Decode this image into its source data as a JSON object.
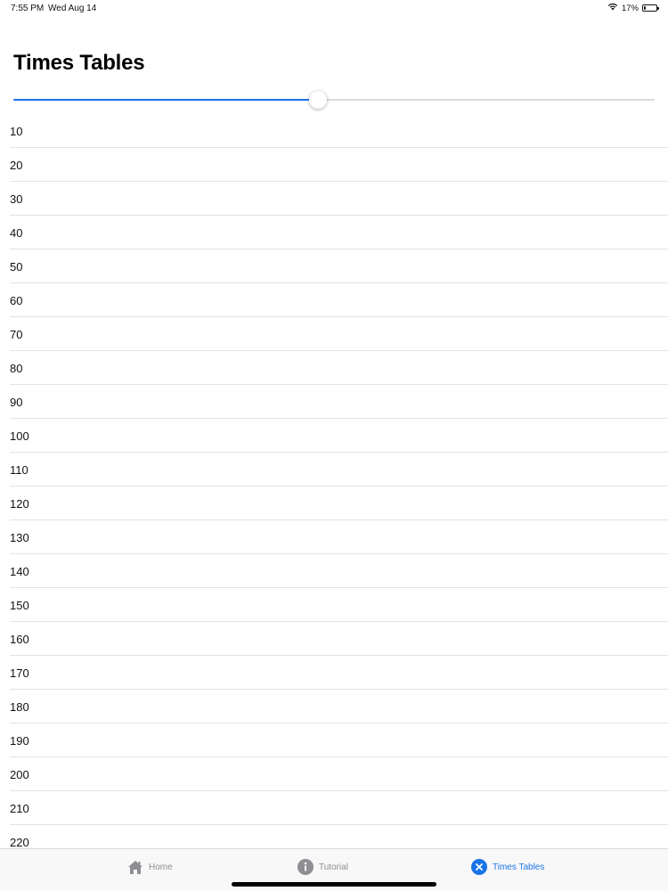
{
  "status_bar": {
    "time": "7:55 PM",
    "date": "Wed Aug 14",
    "battery": "17%",
    "battery_level": 0.17
  },
  "page": {
    "title": "Times Tables"
  },
  "slider": {
    "value": 0.475
  },
  "list": {
    "items": [
      "10",
      "20",
      "30",
      "40",
      "50",
      "60",
      "70",
      "80",
      "90",
      "100",
      "110",
      "120",
      "130",
      "140",
      "150",
      "160",
      "170",
      "180",
      "190",
      "200",
      "210",
      "220"
    ]
  },
  "tabs": [
    {
      "label": "Home",
      "icon": "house-icon",
      "active": false
    },
    {
      "label": "Tutorial",
      "icon": "info-icon",
      "active": false
    },
    {
      "label": "Times Tables",
      "icon": "close-circle-icon",
      "active": true
    }
  ],
  "colors": {
    "accent": "#1a73e8",
    "inactive_tab": "#8e8e93",
    "separator": "#e3e3e6"
  }
}
